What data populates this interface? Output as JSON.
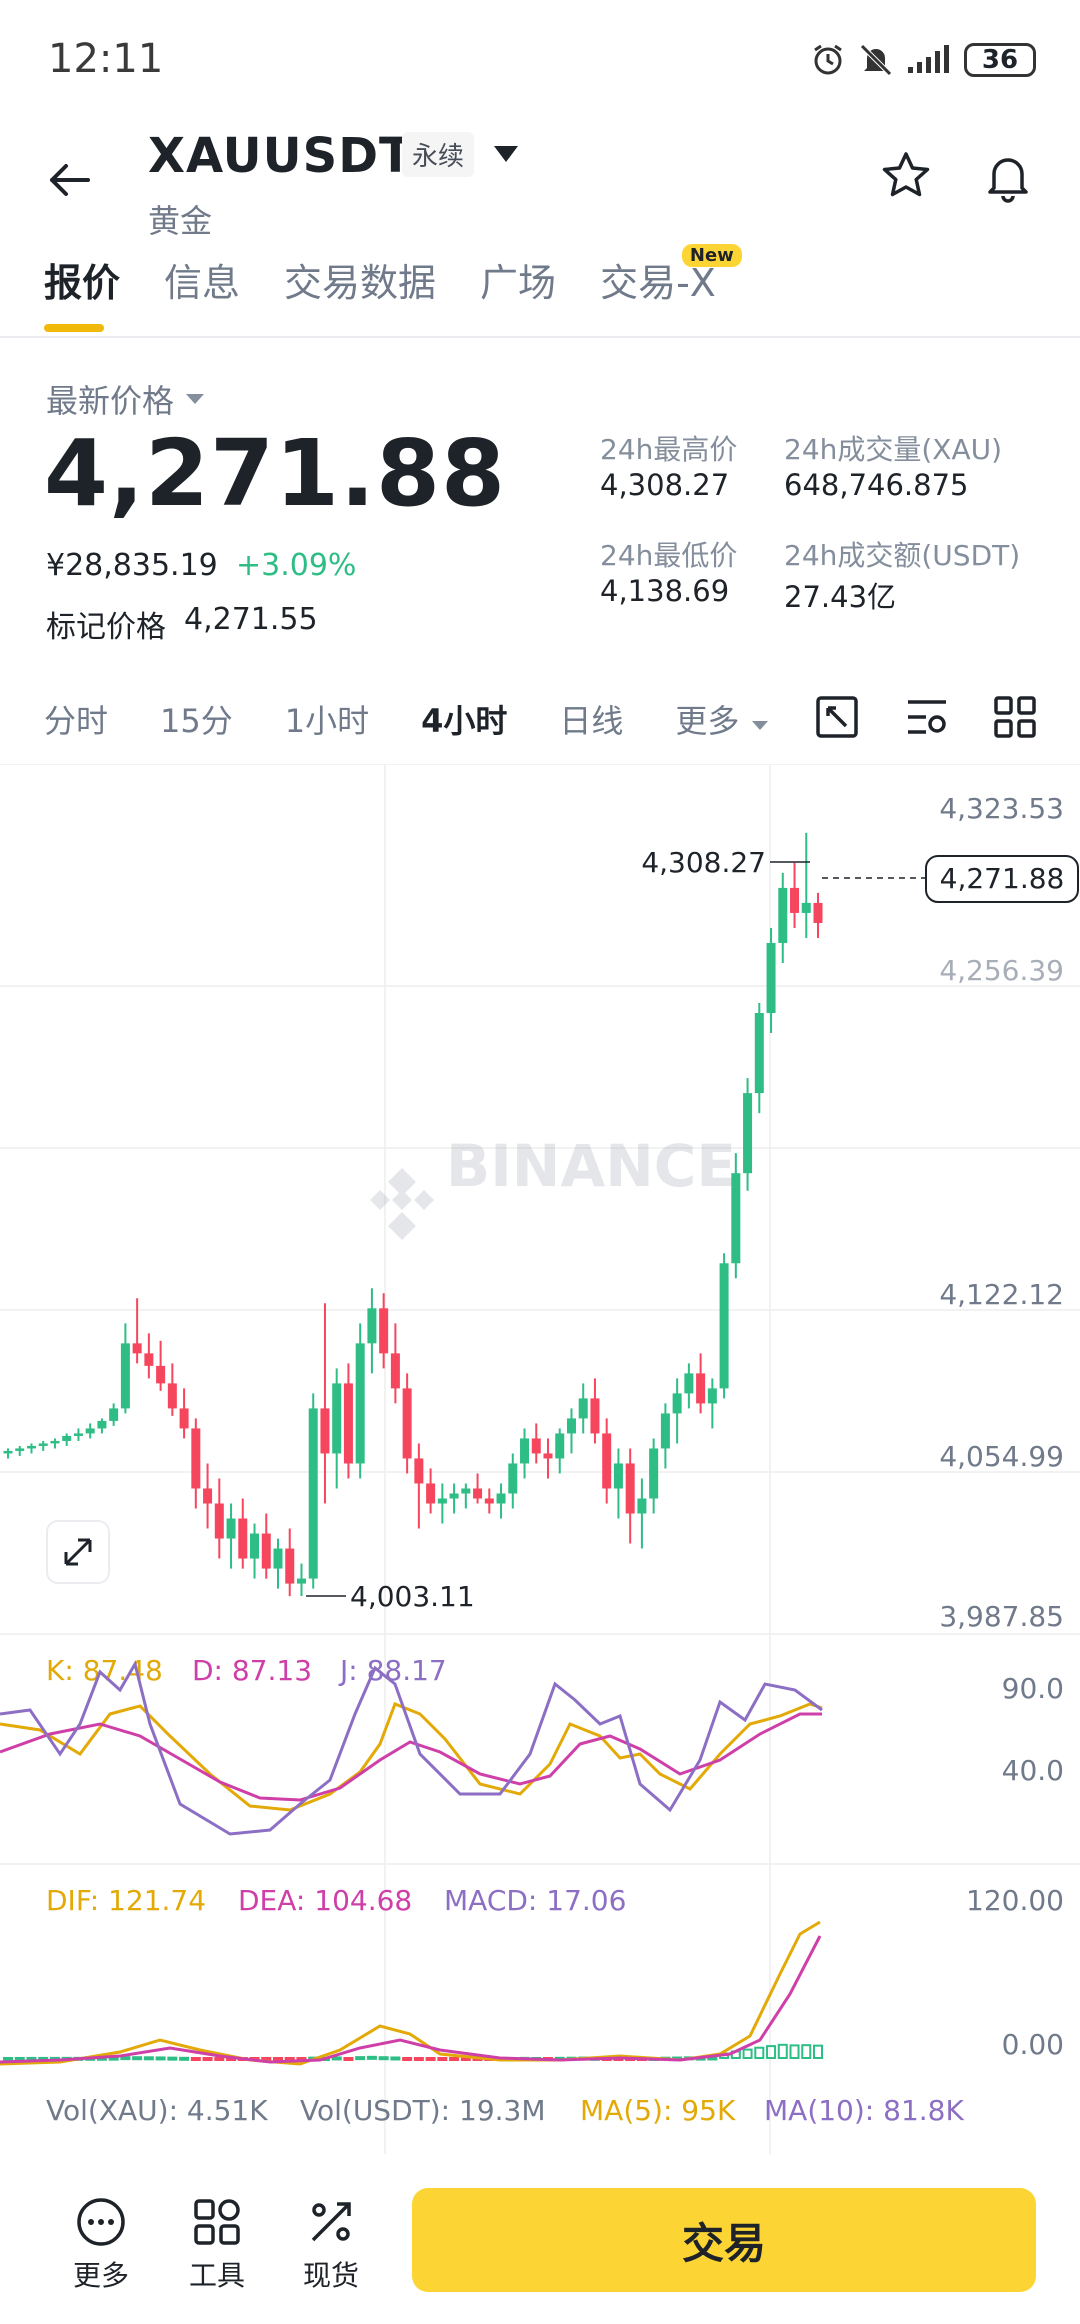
{
  "status_bar": {
    "time": "12:11",
    "battery": "36"
  },
  "header": {
    "symbol": "XAUUSDT",
    "contract_type": "永续",
    "subname": "黄金",
    "icons": [
      "back-arrow-icon",
      "star-icon",
      "bell-icon"
    ]
  },
  "tabs": [
    {
      "label": "报价",
      "active": true
    },
    {
      "label": "信息"
    },
    {
      "label": "交易数据"
    },
    {
      "label": "广场"
    },
    {
      "label": "交易-X",
      "badge": "New"
    }
  ],
  "price": {
    "latest_label": "最新价格",
    "last_price": "4,271.88",
    "cny_price": "¥28,835.19",
    "change_pct": "+3.09%",
    "mark_label": "标记价格",
    "mark_value": "4,271.55"
  },
  "stats": {
    "high_label": "24h最高价",
    "high_value": "4,308.27",
    "low_label": "24h最低价",
    "low_value": "4,138.69",
    "vol_label": "24h成交量(XAU)",
    "vol_value": "648,746.875",
    "amount_label": "24h成交额(USDT)",
    "amount_value": "27.43亿"
  },
  "intervals": [
    "分时",
    "15分",
    "1小时",
    "4小时",
    "日线",
    "更多"
  ],
  "active_interval": "4小时",
  "chart": {
    "watermark": "BINANCE",
    "price_axis": [
      "4,323.53",
      "4,256.39",
      "4,122.12",
      "4,054.99",
      "3,987.85"
    ],
    "high_marker": "4,308.27",
    "low_marker": "4,003.11",
    "current_price_tag": "4,271.88",
    "kdj": {
      "k": "K: 87.48",
      "d": "D: 87.13",
      "j": "J: 88.17",
      "axis": [
        "90.0",
        "40.0"
      ]
    },
    "macd": {
      "dif": "DIF: 121.74",
      "dea": "DEA: 104.68",
      "macd": "MACD: 17.06",
      "axis": [
        "120.00",
        "0.00"
      ]
    },
    "volume": {
      "vol_xau": "Vol(XAU): 4.51K",
      "vol_usdt": "Vol(USDT): 19.3M",
      "ma5": "MA(5): 95K",
      "ma10": "MA(10): 81.8K"
    }
  },
  "chart_data": {
    "type": "candlestick",
    "series_note": "4h candles, approximate OHLC",
    "ylim": [
      3987.85,
      4323.53
    ],
    "candles": [
      [
        4060,
        4062,
        4058,
        4061
      ],
      [
        4061,
        4063,
        4059,
        4062
      ],
      [
        4062,
        4064,
        4060,
        4063
      ],
      [
        4063,
        4065,
        4061,
        4064
      ],
      [
        4064,
        4066,
        4062,
        4065
      ],
      [
        4065,
        4068,
        4063,
        4067
      ],
      [
        4067,
        4070,
        4065,
        4068
      ],
      [
        4068,
        4072,
        4066,
        4070
      ],
      [
        4070,
        4074,
        4068,
        4073
      ],
      [
        4073,
        4080,
        4071,
        4078
      ],
      [
        4078,
        4112,
        4076,
        4104
      ],
      [
        4104,
        4122,
        4096,
        4100
      ],
      [
        4100,
        4108,
        4090,
        4095
      ],
      [
        4095,
        4105,
        4085,
        4088
      ],
      [
        4088,
        4096,
        4075,
        4078
      ],
      [
        4078,
        4086,
        4066,
        4070
      ],
      [
        4070,
        4074,
        4038,
        4046
      ],
      [
        4046,
        4056,
        4030,
        4040
      ],
      [
        4040,
        4050,
        4018,
        4026
      ],
      [
        4026,
        4040,
        4014,
        4034
      ],
      [
        4034,
        4042,
        4014,
        4018
      ],
      [
        4018,
        4032,
        4010,
        4028
      ],
      [
        4028,
        4036,
        4010,
        4014
      ],
      [
        4014,
        4026,
        4006,
        4022
      ],
      [
        4022,
        4030,
        4003,
        4008
      ],
      [
        4008,
        4016,
        4003,
        4010
      ],
      [
        4010,
        4084,
        4006,
        4078
      ],
      [
        4078,
        4120,
        4040,
        4060
      ],
      [
        4060,
        4094,
        4046,
        4088
      ],
      [
        4088,
        4096,
        4050,
        4056
      ],
      [
        4056,
        4112,
        4050,
        4104
      ],
      [
        4104,
        4126,
        4092,
        4118
      ],
      [
        4118,
        4124,
        4094,
        4100
      ],
      [
        4100,
        4112,
        4080,
        4086
      ],
      [
        4086,
        4092,
        4052,
        4058
      ],
      [
        4058,
        4064,
        4030,
        4048
      ],
      [
        4048,
        4054,
        4036,
        4040
      ],
      [
        4040,
        4048,
        4032,
        4042
      ],
      [
        4042,
        4048,
        4036,
        4044
      ],
      [
        4044,
        4048,
        4038,
        4046
      ],
      [
        4046,
        4052,
        4040,
        4042
      ],
      [
        4042,
        4046,
        4036,
        4040
      ],
      [
        4040,
        4048,
        4034,
        4044
      ],
      [
        4044,
        4060,
        4038,
        4056
      ],
      [
        4056,
        4070,
        4050,
        4066
      ],
      [
        4066,
        4072,
        4056,
        4060
      ],
      [
        4060,
        4066,
        4050,
        4058
      ],
      [
        4058,
        4070,
        4052,
        4068
      ],
      [
        4068,
        4078,
        4060,
        4074
      ],
      [
        4074,
        4088,
        4068,
        4082
      ],
      [
        4082,
        4090,
        4064,
        4068
      ],
      [
        4068,
        4074,
        4040,
        4046
      ],
      [
        4046,
        4062,
        4034,
        4056
      ],
      [
        4056,
        4062,
        4024,
        4036
      ],
      [
        4036,
        4050,
        4022,
        4042
      ],
      [
        4042,
        4066,
        4036,
        4062
      ],
      [
        4062,
        4080,
        4054,
        4076
      ],
      [
        4076,
        4090,
        4064,
        4084
      ],
      [
        4084,
        4096,
        4078,
        4092
      ],
      [
        4092,
        4100,
        4076,
        4080
      ],
      [
        4080,
        4090,
        4070,
        4086
      ],
      [
        4086,
        4140,
        4082,
        4136
      ],
      [
        4136,
        4180,
        4130,
        4172
      ],
      [
        4172,
        4210,
        4165,
        4204
      ],
      [
        4204,
        4240,
        4196,
        4236
      ],
      [
        4236,
        4270,
        4228,
        4264
      ],
      [
        4264,
        4292,
        4256,
        4286
      ],
      [
        4286,
        4296,
        4270,
        4276
      ],
      [
        4276,
        4308,
        4266,
        4280
      ],
      [
        4280,
        4284,
        4266,
        4272
      ]
    ]
  }
}
